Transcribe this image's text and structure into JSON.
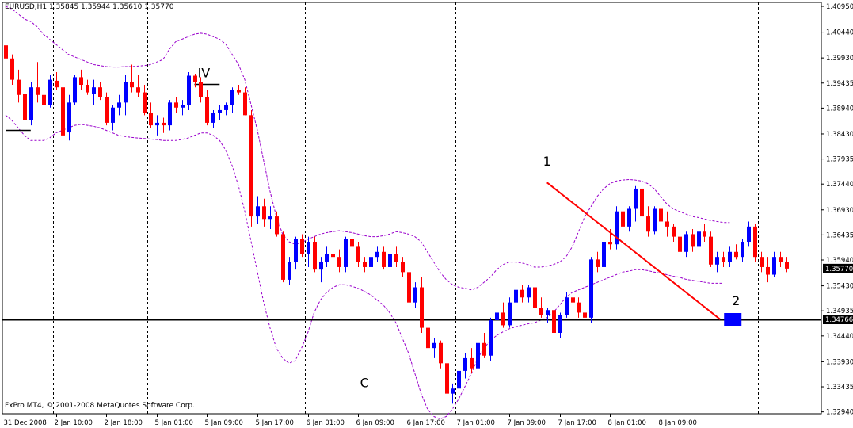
{
  "header": {
    "symbol_label": "EURUSD,H1  1.35845 1.35944 1.35610 1.35770"
  },
  "footer": {
    "copyright": "FxPro MT4, © 2001-2008 MetaQuotes Software Corp."
  },
  "colors": {
    "background": "#ffffff",
    "bull": "#0000ff",
    "bear": "#ff0000",
    "band": "#9900cc",
    "trendline": "#ff0000",
    "target_box": "#0000ff",
    "bidline": "#8fa3b8"
  },
  "chart_data": {
    "type": "candlestick",
    "ylim": [
      1.3295,
      1.4095
    ],
    "y_ticks": [
      "1.40950",
      "1.40440",
      "1.39930",
      "1.39435",
      "1.38940",
      "1.38430",
      "1.37935",
      "1.37440",
      "1.36930",
      "1.36435",
      "1.35940",
      "1.35430",
      "1.34935",
      "1.34440",
      "1.33930",
      "1.33435",
      "1.32940"
    ],
    "x_ticks": [
      "31 Dec 2008",
      "2 Jan 10:00",
      "2 Jan 18:00",
      "5 Jan 01:00",
      "5 Jan 09:00",
      "5 Jan 17:00",
      "6 Jan 01:00",
      "6 Jan 09:00",
      "6 Jan 17:00",
      "7 Jan 01:00",
      "7 Jan 09:00",
      "7 Jan 17:00",
      "8 Jan 01:00",
      "8 Jan 09:00"
    ],
    "x_tick_bars": [
      0,
      8,
      16,
      24,
      32,
      40,
      48,
      56,
      64,
      72,
      80,
      88,
      96,
      104
    ],
    "period_separators": [
      7.5,
      22.5,
      23.5,
      47.5,
      71.5,
      95.5,
      119.5
    ],
    "current_price": "1.35770",
    "horizontal_line": {
      "price": 1.34766,
      "label": "1.34766"
    },
    "wave_labels": [
      {
        "text": "IV",
        "bar": 31.5,
        "price": 1.3955
      },
      {
        "text": "1",
        "bar": 86,
        "price": 1.378
      },
      {
        "text": "C",
        "bar": 57,
        "price": 1.3343
      },
      {
        "text": "2",
        "bar": 116,
        "price": 1.3505
      }
    ],
    "short_levels": [
      {
        "bar_from": 0,
        "bar_to": 4,
        "price": 1.385
      },
      {
        "bar_from": 30,
        "bar_to": 34,
        "price": 1.3942
      }
    ],
    "trendline": {
      "from": {
        "bar": 86,
        "price": 1.3747
      },
      "to": {
        "bar": 113.5,
        "price": 1.34766
      }
    },
    "target_box": {
      "bar": 115.5,
      "price": 1.34766
    },
    "candles": [
      [
        1.4018,
        1.4068,
        1.3987,
        1.3992
      ],
      [
        1.3992,
        1.4,
        1.394,
        1.395
      ],
      [
        1.395,
        1.397,
        1.3905,
        1.392
      ],
      [
        1.3922,
        1.394,
        1.3855,
        1.387
      ],
      [
        1.387,
        1.3945,
        1.386,
        1.3935
      ],
      [
        1.3935,
        1.3985,
        1.3905,
        1.392
      ],
      [
        1.392,
        1.3935,
        1.389,
        1.39
      ],
      [
        1.39,
        1.396,
        1.3895,
        1.395
      ],
      [
        1.3948,
        1.3965,
        1.393,
        1.3935
      ],
      [
        1.3935,
        1.394,
        1.384,
        1.384
      ],
      [
        1.3846,
        1.392,
        1.383,
        1.3905
      ],
      [
        1.3905,
        1.396,
        1.39,
        1.3955
      ],
      [
        1.3955,
        1.397,
        1.393,
        1.394
      ],
      [
        1.394,
        1.395,
        1.392,
        1.3925
      ],
      [
        1.3922,
        1.395,
        1.39,
        1.3935
      ],
      [
        1.3935,
        1.3945,
        1.391,
        1.3915
      ],
      [
        1.3915,
        1.3925,
        1.386,
        1.3865
      ],
      [
        1.3865,
        1.39,
        1.385,
        1.3895
      ],
      [
        1.3895,
        1.392,
        1.388,
        1.3905
      ],
      [
        1.3905,
        1.396,
        1.388,
        1.3945
      ],
      [
        1.3945,
        1.398,
        1.3925,
        1.3935
      ],
      [
        1.3935,
        1.396,
        1.3915,
        1.3925
      ],
      [
        1.3925,
        1.394,
        1.388,
        1.3885
      ],
      [
        1.3885,
        1.3905,
        1.3855,
        1.386
      ],
      [
        1.386,
        1.388,
        1.384,
        1.3865
      ],
      [
        1.3865,
        1.3875,
        1.3845,
        1.386
      ],
      [
        1.386,
        1.391,
        1.385,
        1.3905
      ],
      [
        1.3905,
        1.3915,
        1.3885,
        1.3895
      ],
      [
        1.3895,
        1.391,
        1.388,
        1.39
      ],
      [
        1.39,
        1.3965,
        1.389,
        1.3958
      ],
      [
        1.3958,
        1.3962,
        1.3935,
        1.3945
      ],
      [
        1.3945,
        1.3955,
        1.3905,
        1.3915
      ],
      [
        1.3915,
        1.393,
        1.386,
        1.3865
      ],
      [
        1.3865,
        1.389,
        1.3855,
        1.3885
      ],
      [
        1.3885,
        1.39,
        1.387,
        1.389
      ],
      [
        1.389,
        1.3905,
        1.388,
        1.39
      ],
      [
        1.39,
        1.3935,
        1.3885,
        1.393
      ],
      [
        1.393,
        1.394,
        1.392,
        1.3925
      ],
      [
        1.3925,
        1.3935,
        1.388,
        1.388
      ],
      [
        1.388,
        1.389,
        1.366,
        1.368
      ],
      [
        1.368,
        1.372,
        1.3665,
        1.37
      ],
      [
        1.37,
        1.3715,
        1.366,
        1.3675
      ],
      [
        1.3675,
        1.37,
        1.3655,
        1.368
      ],
      [
        1.368,
        1.369,
        1.364,
        1.3645
      ],
      [
        1.3645,
        1.365,
        1.355,
        1.3555
      ],
      [
        1.3555,
        1.36,
        1.3545,
        1.359
      ],
      [
        1.359,
        1.364,
        1.3575,
        1.3635
      ],
      [
        1.3635,
        1.3645,
        1.36,
        1.3605
      ],
      [
        1.3605,
        1.364,
        1.358,
        1.363
      ],
      [
        1.363,
        1.364,
        1.357,
        1.3575
      ],
      [
        1.3575,
        1.36,
        1.355,
        1.359
      ],
      [
        1.359,
        1.362,
        1.358,
        1.3605
      ],
      [
        1.3605,
        1.364,
        1.359,
        1.36
      ],
      [
        1.36,
        1.3615,
        1.357,
        1.358
      ],
      [
        1.358,
        1.364,
        1.357,
        1.3635
      ],
      [
        1.3635,
        1.365,
        1.361,
        1.362
      ],
      [
        1.362,
        1.363,
        1.358,
        1.359
      ],
      [
        1.359,
        1.36,
        1.357,
        1.358
      ],
      [
        1.358,
        1.361,
        1.357,
        1.36
      ],
      [
        1.36,
        1.362,
        1.359,
        1.361
      ],
      [
        1.361,
        1.362,
        1.3575,
        1.358
      ],
      [
        1.358,
        1.3615,
        1.357,
        1.3605
      ],
      [
        1.3605,
        1.362,
        1.358,
        1.359
      ],
      [
        1.359,
        1.36,
        1.356,
        1.357
      ],
      [
        1.357,
        1.358,
        1.35,
        1.351
      ],
      [
        1.351,
        1.355,
        1.35,
        1.354
      ],
      [
        1.354,
        1.356,
        1.345,
        1.346
      ],
      [
        1.346,
        1.348,
        1.34,
        1.342
      ],
      [
        1.342,
        1.344,
        1.34,
        1.343
      ],
      [
        1.343,
        1.3435,
        1.338,
        1.339
      ],
      [
        1.339,
        1.34,
        1.332,
        1.333
      ],
      [
        1.333,
        1.335,
        1.331,
        1.334
      ],
      [
        1.334,
        1.338,
        1.332,
        1.3375
      ],
      [
        1.3375,
        1.341,
        1.336,
        1.34
      ],
      [
        1.34,
        1.342,
        1.337,
        1.338
      ],
      [
        1.338,
        1.344,
        1.337,
        1.343
      ],
      [
        1.343,
        1.345,
        1.34,
        1.3405
      ],
      [
        1.3405,
        1.348,
        1.3395,
        1.3475
      ],
      [
        1.3475,
        1.35,
        1.3455,
        1.349
      ],
      [
        1.349,
        1.351,
        1.346,
        1.3465
      ],
      [
        1.3465,
        1.352,
        1.346,
        1.351
      ],
      [
        1.351,
        1.355,
        1.35,
        1.3535
      ],
      [
        1.3535,
        1.3545,
        1.351,
        1.352
      ],
      [
        1.352,
        1.3545,
        1.351,
        1.354
      ],
      [
        1.354,
        1.355,
        1.3495,
        1.35
      ],
      [
        1.35,
        1.352,
        1.348,
        1.3485
      ],
      [
        1.3485,
        1.35,
        1.347,
        1.3495
      ],
      [
        1.3495,
        1.3505,
        1.344,
        1.345
      ],
      [
        1.345,
        1.349,
        1.344,
        1.3485
      ],
      [
        1.3485,
        1.353,
        1.348,
        1.352
      ],
      [
        1.352,
        1.353,
        1.35,
        1.351
      ],
      [
        1.351,
        1.352,
        1.348,
        1.349
      ],
      [
        1.349,
        1.352,
        1.3475,
        1.348
      ],
      [
        1.348,
        1.36,
        1.347,
        1.3595
      ],
      [
        1.3595,
        1.361,
        1.357,
        1.358
      ],
      [
        1.358,
        1.364,
        1.356,
        1.363
      ],
      [
        1.363,
        1.3655,
        1.3615,
        1.3625
      ],
      [
        1.3625,
        1.37,
        1.3615,
        1.369
      ],
      [
        1.369,
        1.372,
        1.365,
        1.366
      ],
      [
        1.366,
        1.37,
        1.365,
        1.3695
      ],
      [
        1.3695,
        1.374,
        1.367,
        1.3735
      ],
      [
        1.3735,
        1.3745,
        1.367,
        1.368
      ],
      [
        1.368,
        1.37,
        1.364,
        1.365
      ],
      [
        1.365,
        1.37,
        1.3645,
        1.3695
      ],
      [
        1.3695,
        1.372,
        1.366,
        1.367
      ],
      [
        1.367,
        1.369,
        1.364,
        1.366
      ],
      [
        1.366,
        1.3665,
        1.363,
        1.364
      ],
      [
        1.364,
        1.365,
        1.36,
        1.361
      ],
      [
        1.361,
        1.365,
        1.36,
        1.3645
      ],
      [
        1.3645,
        1.3655,
        1.361,
        1.362
      ],
      [
        1.362,
        1.366,
        1.361,
        1.365
      ],
      [
        1.365,
        1.3665,
        1.363,
        1.364
      ],
      [
        1.364,
        1.365,
        1.358,
        1.3585
      ],
      [
        1.3585,
        1.361,
        1.357,
        1.36
      ],
      [
        1.36,
        1.361,
        1.358,
        1.359
      ],
      [
        1.359,
        1.362,
        1.358,
        1.361
      ],
      [
        1.361,
        1.3625,
        1.3595,
        1.36
      ],
      [
        1.36,
        1.3635,
        1.359,
        1.363
      ],
      [
        1.363,
        1.367,
        1.362,
        1.366
      ],
      [
        1.366,
        1.3665,
        1.359,
        1.36
      ],
      [
        1.36,
        1.361,
        1.357,
        1.358
      ],
      [
        1.358,
        1.36,
        1.355,
        1.3565
      ],
      [
        1.3565,
        1.361,
        1.356,
        1.36
      ],
      [
        1.36,
        1.361,
        1.358,
        1.359
      ],
      [
        1.359,
        1.36,
        1.357,
        1.3577
      ]
    ],
    "bands": {
      "upper": [
        1.4095,
        1.409,
        1.408,
        1.407,
        1.4065,
        1.4055,
        1.404,
        1.403,
        1.402,
        1.401,
        1.4,
        1.3995,
        1.399,
        1.3985,
        1.398,
        1.3978,
        1.3976,
        1.3975,
        1.3975,
        1.3976,
        1.3976,
        1.3977,
        1.3978,
        1.398,
        1.3985,
        1.399,
        1.401,
        1.4025,
        1.403,
        1.4035,
        1.404,
        1.4042,
        1.404,
        1.4035,
        1.403,
        1.402,
        1.4,
        1.398,
        1.395,
        1.39,
        1.385,
        1.379,
        1.373,
        1.368,
        1.3645,
        1.363,
        1.3625,
        1.3628,
        1.3635,
        1.364,
        1.3645,
        1.3648,
        1.365,
        1.3652,
        1.365,
        1.3648,
        1.3645,
        1.3642,
        1.364,
        1.364,
        1.3642,
        1.3645,
        1.365,
        1.3648,
        1.3645,
        1.364,
        1.363,
        1.361,
        1.359,
        1.357,
        1.3555,
        1.3545,
        1.354,
        1.3538,
        1.3535,
        1.354,
        1.355,
        1.356,
        1.3575,
        1.3585,
        1.359,
        1.359,
        1.3588,
        1.3585,
        1.358,
        1.358,
        1.3582,
        1.3585,
        1.359,
        1.36,
        1.362,
        1.365,
        1.368,
        1.37,
        1.372,
        1.3735,
        1.3745,
        1.375,
        1.3752,
        1.3753,
        1.3752,
        1.375,
        1.3745,
        1.3735,
        1.372,
        1.3705,
        1.3695,
        1.369,
        1.3685,
        1.368,
        1.3678,
        1.3675,
        1.3672,
        1.367,
        1.3668,
        1.3668
      ],
      "lower": [
        1.388,
        1.387,
        1.3855,
        1.384,
        1.383,
        1.383,
        1.383,
        1.3835,
        1.3845,
        1.385,
        1.3855,
        1.386,
        1.3862,
        1.386,
        1.3858,
        1.3855,
        1.385,
        1.3845,
        1.384,
        1.3838,
        1.3836,
        1.3835,
        1.3834,
        1.3833,
        1.3832,
        1.383,
        1.383,
        1.383,
        1.3832,
        1.3835,
        1.384,
        1.3845,
        1.3845,
        1.384,
        1.383,
        1.381,
        1.378,
        1.374,
        1.369,
        1.363,
        1.357,
        1.351,
        1.346,
        1.342,
        1.34,
        1.339,
        1.3395,
        1.342,
        1.345,
        1.349,
        1.3515,
        1.353,
        1.354,
        1.3545,
        1.3545,
        1.3542,
        1.3538,
        1.3532,
        1.3525,
        1.3515,
        1.3505,
        1.349,
        1.347,
        1.344,
        1.341,
        1.337,
        1.333,
        1.33,
        1.3285,
        1.328,
        1.3285,
        1.33,
        1.332,
        1.3345,
        1.337,
        1.34,
        1.342,
        1.3435,
        1.3445,
        1.3452,
        1.3458,
        1.3462,
        1.3465,
        1.3468,
        1.347,
        1.3475,
        1.348,
        1.349,
        1.3505,
        1.352,
        1.353,
        1.3535,
        1.354,
        1.3545,
        1.355,
        1.3555,
        1.356,
        1.3565,
        1.357,
        1.3572,
        1.3575,
        1.3575,
        1.3573,
        1.357,
        1.3568,
        1.3565,
        1.3562,
        1.356,
        1.3556,
        1.3554,
        1.3552,
        1.355,
        1.3548,
        1.3548,
        1.3548
      ]
    }
  }
}
